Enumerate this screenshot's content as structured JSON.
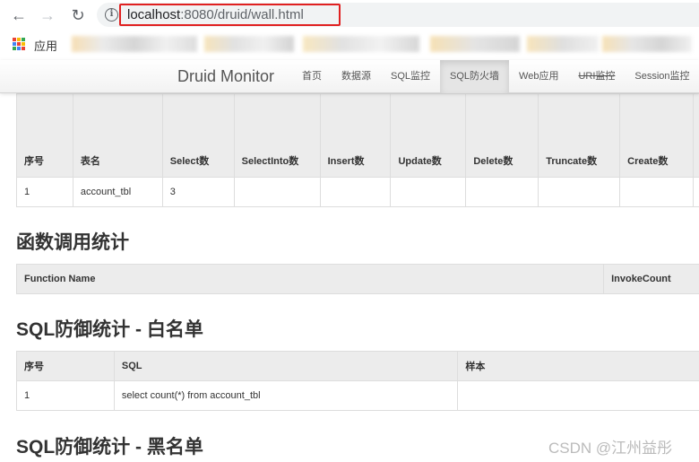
{
  "browser": {
    "url_host": "localhost",
    "url_rest": ":8080/druid/wall.html",
    "bookmarks_apps_label": "应用",
    "apps_colors": [
      "#ea4335",
      "#fbbc05",
      "#34a853",
      "#4285f4",
      "#ea4335",
      "#fbbc05",
      "#34a853",
      "#4285f4",
      "#ea4335"
    ]
  },
  "header": {
    "brand": "Druid Monitor",
    "menu": [
      {
        "label": "首页"
      },
      {
        "label": "数据源"
      },
      {
        "label": "SQL监控"
      },
      {
        "label": "SQL防火墙",
        "active": true
      },
      {
        "label": "Web应用"
      },
      {
        "label": "URI监控"
      },
      {
        "label": "Session监控"
      }
    ]
  },
  "table_stats": {
    "columns": [
      "序号",
      "表名",
      "Select数",
      "SelectInto数",
      "Insert数",
      "Update数",
      "Delete数",
      "Truncate数",
      "Create数",
      ""
    ],
    "rows": [
      [
        "1",
        "account_tbl",
        "3",
        "",
        "",
        "",
        "",
        "",
        "",
        ""
      ]
    ]
  },
  "function_section": {
    "title": "函数调用统计",
    "columns": [
      "Function Name",
      "InvokeCount"
    ]
  },
  "whitelist_section": {
    "title": "SQL防御统计 - 白名单",
    "columns": [
      "序号",
      "SQL",
      "样本"
    ],
    "rows": [
      [
        "1",
        "select count(*) from account_tbl",
        ""
      ]
    ]
  },
  "blacklist_section": {
    "title": "SQL防御统计 - 黑名单"
  },
  "watermark": "CSDN @江州益彤"
}
